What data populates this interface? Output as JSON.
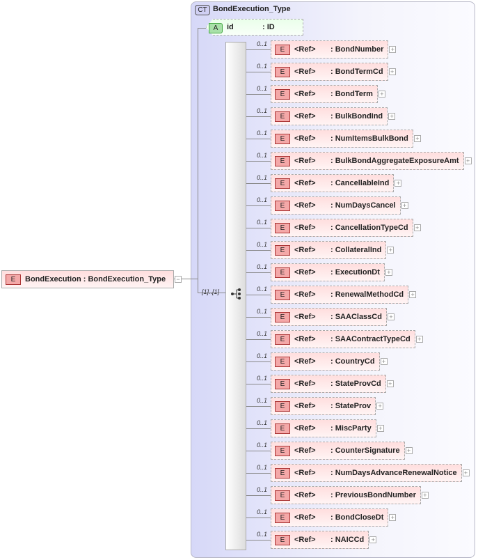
{
  "root": {
    "badge": "E",
    "name": "BondExecution",
    "type": ": BondExecution_Type"
  },
  "complex_type": {
    "badge": "CT",
    "name": "BondExecution_Type"
  },
  "attribute": {
    "badge": "A",
    "name": "id",
    "type": ": ID"
  },
  "sequence": {
    "cardinality": "[1]..[1]"
  },
  "elements": [
    {
      "card": "0..1",
      "ref": "<Ref>",
      "type": ": BondNumber"
    },
    {
      "card": "0..1",
      "ref": "<Ref>",
      "type": ": BondTermCd"
    },
    {
      "card": "0..1",
      "ref": "<Ref>",
      "type": ": BondTerm"
    },
    {
      "card": "0..1",
      "ref": "<Ref>",
      "type": ": BulkBondInd"
    },
    {
      "card": "0..1",
      "ref": "<Ref>",
      "type": ": NumItemsBulkBond"
    },
    {
      "card": "0..1",
      "ref": "<Ref>",
      "type": ": BulkBondAggregateExposureAmt"
    },
    {
      "card": "0..1",
      "ref": "<Ref>",
      "type": ": CancellableInd"
    },
    {
      "card": "0..1",
      "ref": "<Ref>",
      "type": ": NumDaysCancel"
    },
    {
      "card": "0..1",
      "ref": "<Ref>",
      "type": ": CancellationTypeCd"
    },
    {
      "card": "0..1",
      "ref": "<Ref>",
      "type": ": CollateralInd"
    },
    {
      "card": "0..1",
      "ref": "<Ref>",
      "type": ": ExecutionDt"
    },
    {
      "card": "0..1",
      "ref": "<Ref>",
      "type": ": RenewalMethodCd"
    },
    {
      "card": "0..1",
      "ref": "<Ref>",
      "type": ": SAAClassCd"
    },
    {
      "card": "0..1",
      "ref": "<Ref>",
      "type": ": SAAContractTypeCd"
    },
    {
      "card": "0..1",
      "ref": "<Ref>",
      "type": ": CountryCd"
    },
    {
      "card": "0..1",
      "ref": "<Ref>",
      "type": ": StateProvCd"
    },
    {
      "card": "0..1",
      "ref": "<Ref>",
      "type": ": StateProv"
    },
    {
      "card": "0..1",
      "ref": "<Ref>",
      "type": ": MiscParty"
    },
    {
      "card": "0..1",
      "ref": "<Ref>",
      "type": ": CounterSignature"
    },
    {
      "card": "0..1",
      "ref": "<Ref>",
      "type": ": NumDaysAdvanceRenewalNotice"
    },
    {
      "card": "0..1",
      "ref": "<Ref>",
      "type": ": PreviousBondNumber"
    },
    {
      "card": "0..1",
      "ref": "<Ref>",
      "type": ": BondCloseDt"
    },
    {
      "card": "0..1",
      "ref": "<Ref>",
      "type": ": NAICCd"
    }
  ],
  "element_badge": "E"
}
